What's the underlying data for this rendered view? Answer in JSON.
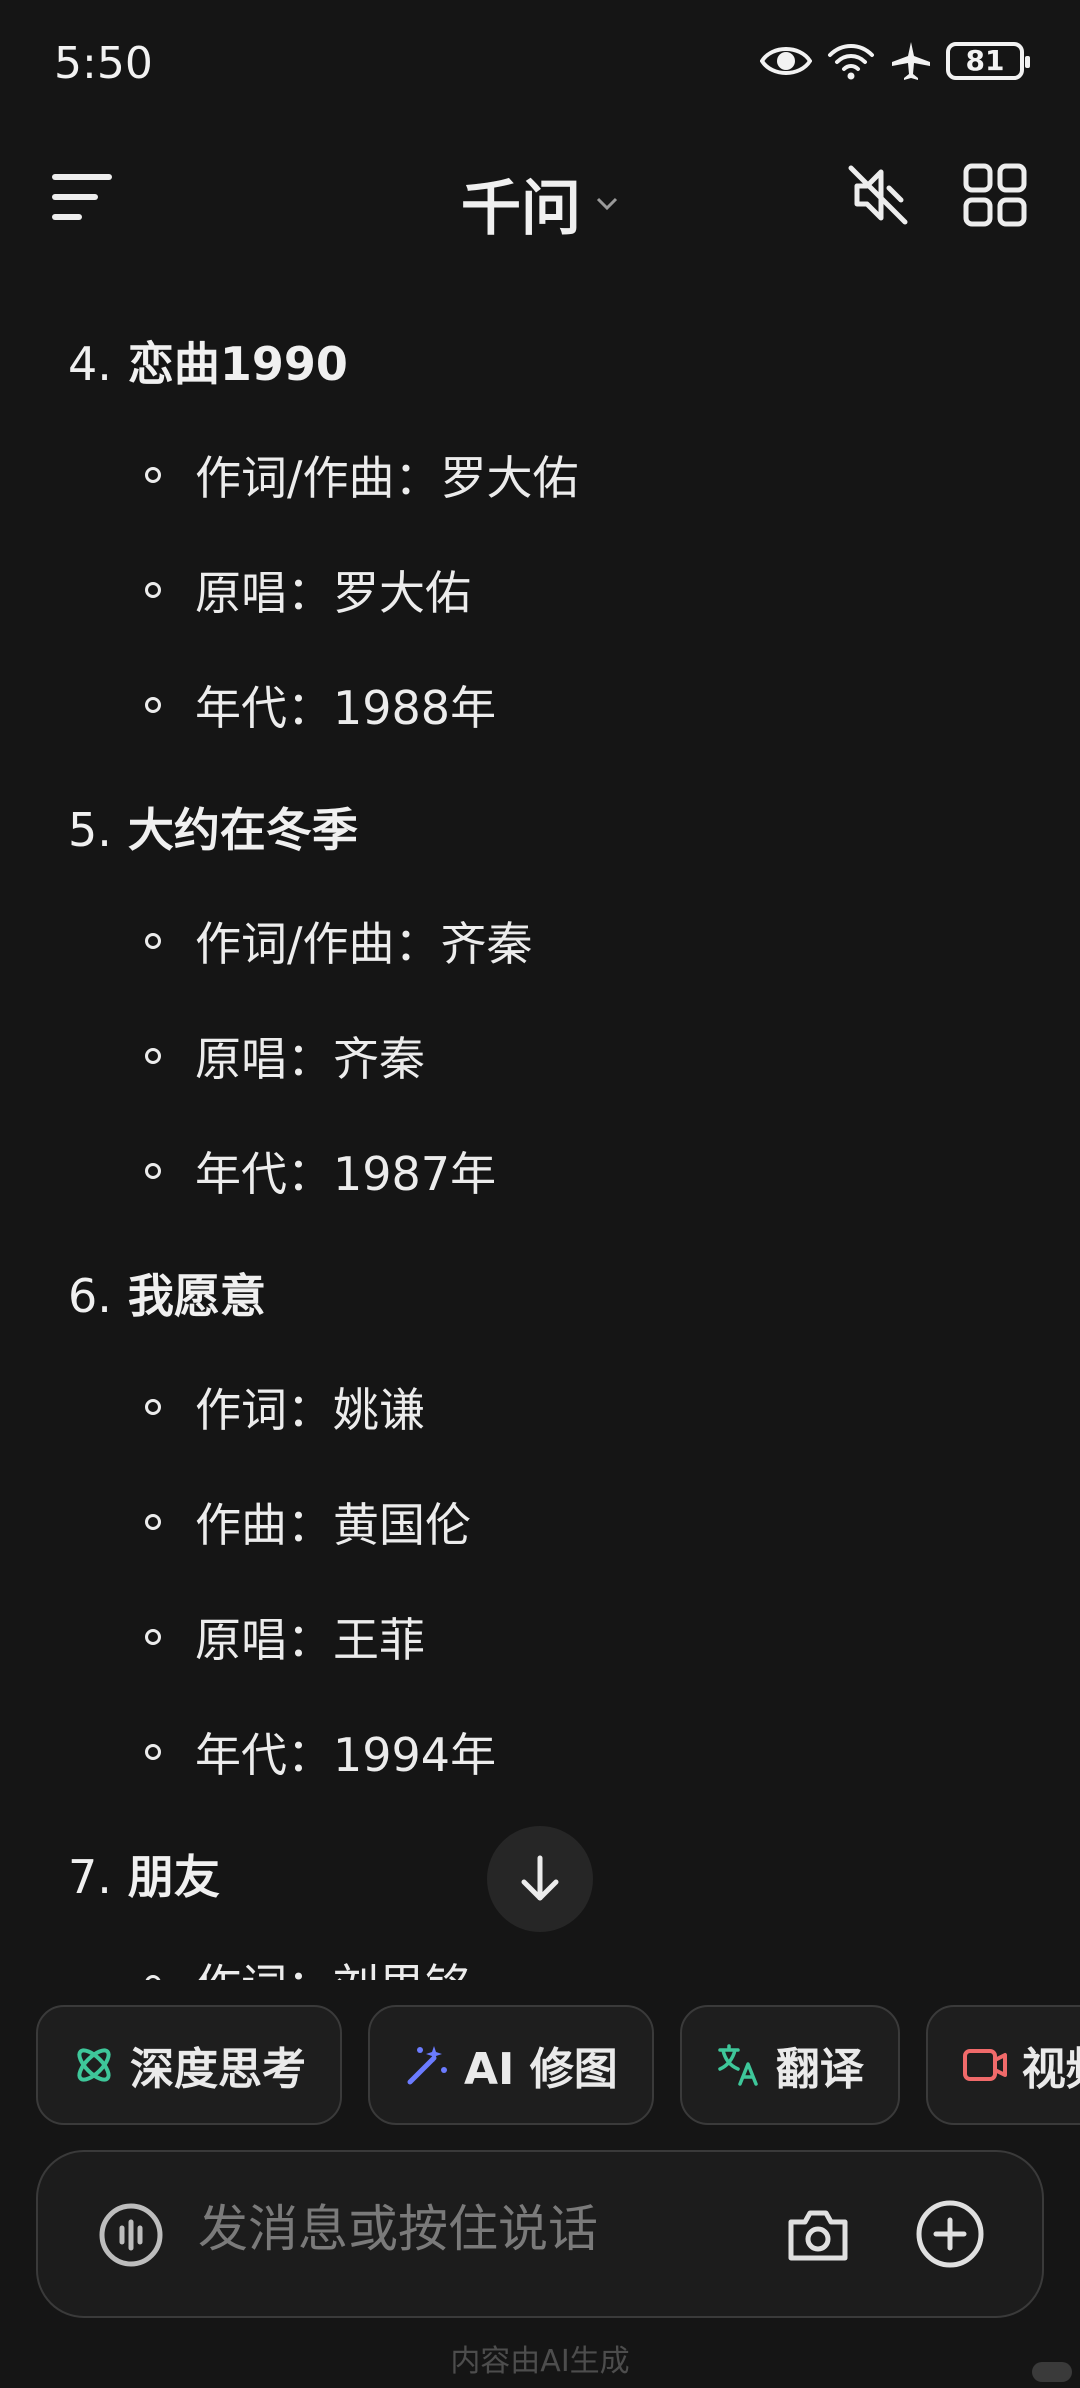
{
  "status_bar": {
    "time": "5:50",
    "battery": "81"
  },
  "header": {
    "title": "千问"
  },
  "songs": [
    {
      "num": "4.",
      "title": "恋曲1990",
      "details": [
        "作词/作曲：罗大佑",
        "原唱：罗大佑",
        "年代：1988年"
      ]
    },
    {
      "num": "5.",
      "title": "大约在冬季",
      "details": [
        "作词/作曲：齐秦",
        "原唱：齐秦",
        "年代：1987年"
      ]
    },
    {
      "num": "6.",
      "title": "我愿意",
      "details": [
        "作词：姚谦",
        "作曲：黄国伦",
        "原唱：王菲",
        "年代：1994年"
      ]
    },
    {
      "num": "7.",
      "title": "朋友",
      "details": [
        "作词：刘思铭"
      ]
    }
  ],
  "chips": [
    {
      "label": "深度思考",
      "icon": "atom-icon",
      "color": "#3ec79a"
    },
    {
      "label": "AI 修图",
      "icon": "magic-wand-icon",
      "color": "#6b7bff"
    },
    {
      "label": "翻译",
      "icon": "translate-icon",
      "color": "#3ec79a"
    },
    {
      "label": "视频",
      "icon": "video-icon",
      "color": "#f06a6a"
    }
  ],
  "input": {
    "placeholder": "发消息或按住说话"
  },
  "footer": {
    "note": "内容由AI生成"
  }
}
